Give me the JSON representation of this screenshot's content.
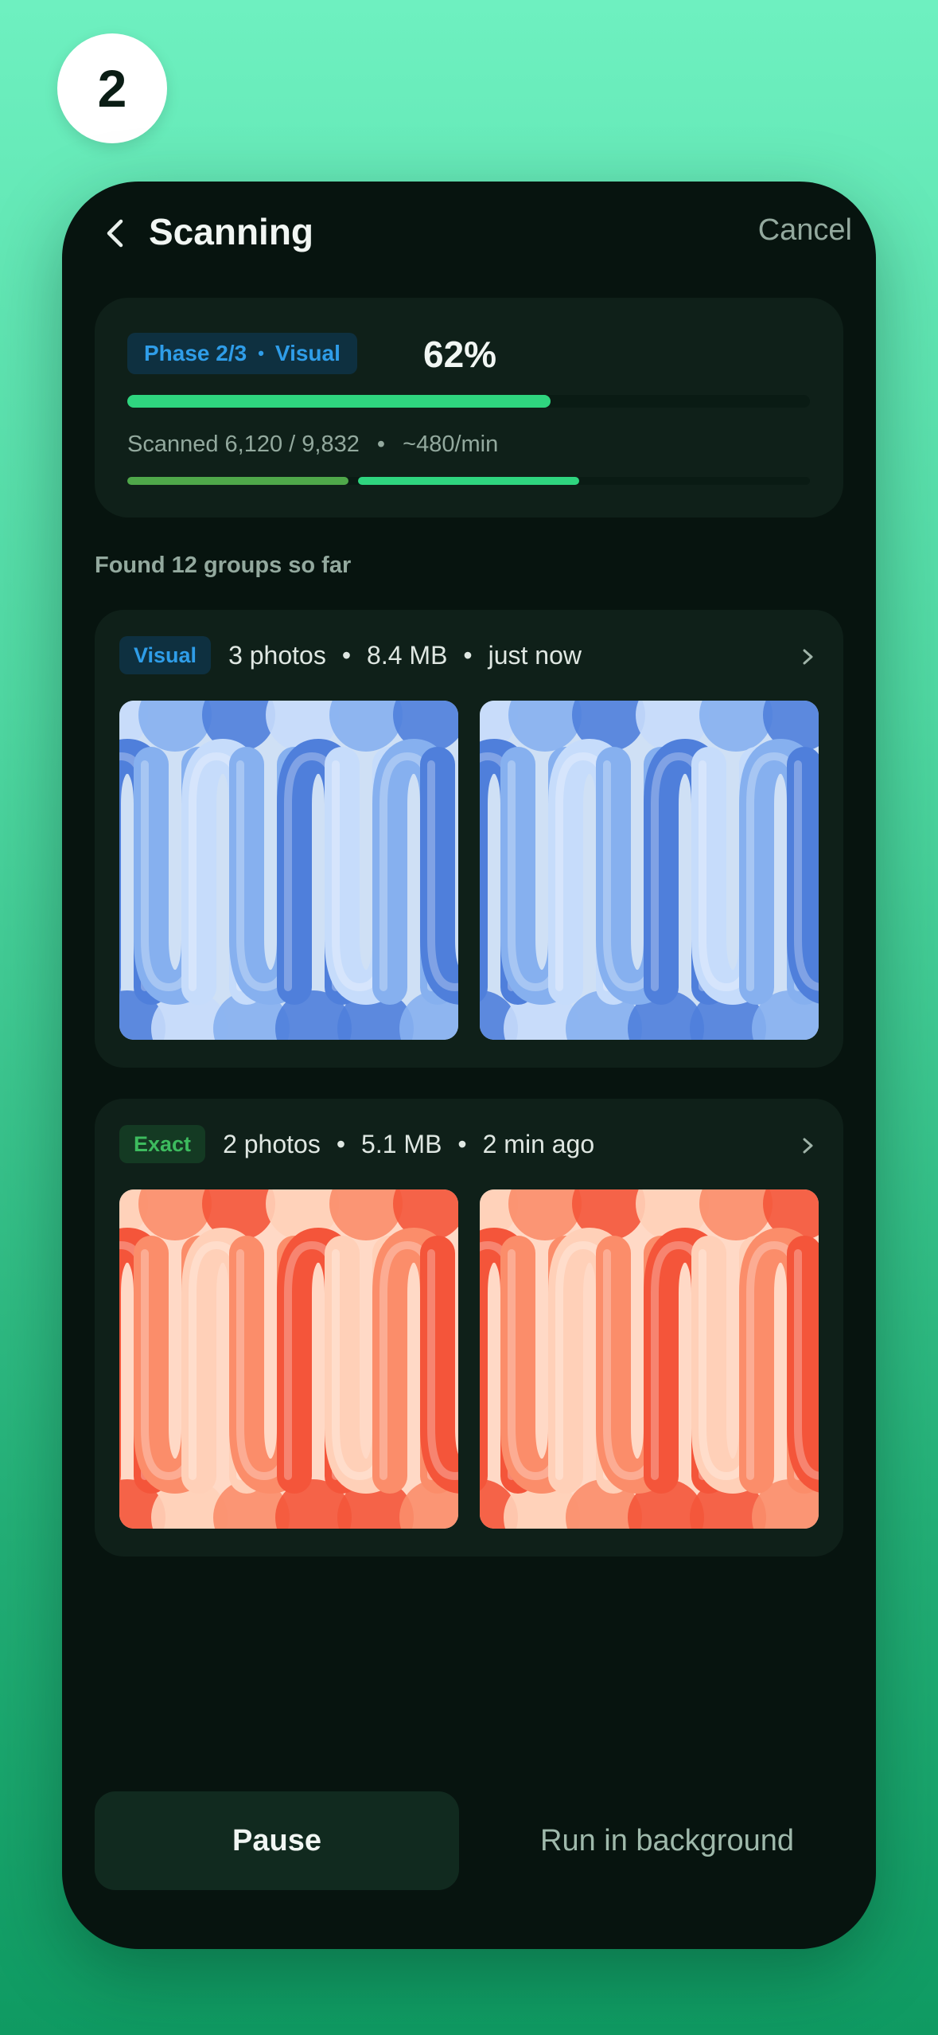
{
  "step_number": "2",
  "header": {
    "title": "Scanning",
    "cancel_label": "Cancel"
  },
  "progress": {
    "phase_label": "Phase 2/3",
    "phase_mode": "Visual",
    "percent_label": "62%",
    "fraction": 0.62,
    "scanned_text": "Scanned 6,120 / 9,832",
    "rate_text": "~480/min",
    "phases": [
      {
        "fraction": 1.0,
        "color": "#4fa84a"
      },
      {
        "fraction": 1.0,
        "color": "#2fd57f"
      },
      {
        "fraction": 0.0,
        "color": "#2fd57f"
      }
    ]
  },
  "found_text": "Found 12 groups so far",
  "groups": [
    {
      "tag": "Visual",
      "count": "3 photos",
      "size": "8.4 MB",
      "time": "just now",
      "palette": {
        "bg": "#cfe0f5",
        "dark": "#4f7fdb",
        "mid": "#86b0ef",
        "light": "#c6dcfb"
      }
    },
    {
      "tag": "Exact",
      "count": "2 photos",
      "size": "5.1 MB",
      "time": "2 min ago",
      "palette": {
        "bg": "#ffd9c6",
        "dark": "#f4553a",
        "mid": "#fb8d6a",
        "light": "#ffd0b8"
      }
    }
  ],
  "actions": {
    "pause_label": "Pause",
    "background_label": "Run in background"
  },
  "colors": {
    "accent_green": "#2fd57f",
    "visual_blue": "#2f9de8",
    "exact_green": "#3dbb5e",
    "panel": "#0f2019",
    "screen": "#07140f"
  }
}
